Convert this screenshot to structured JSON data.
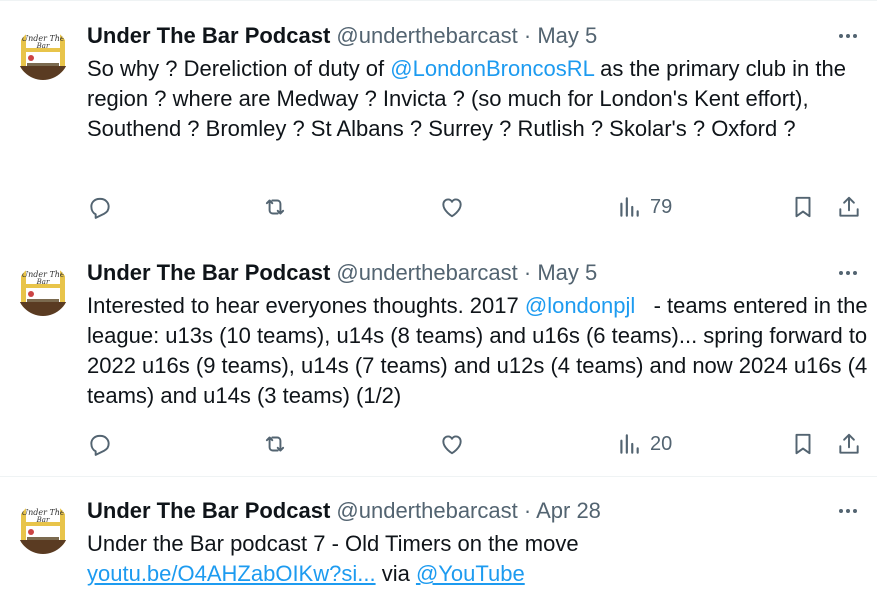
{
  "colors": {
    "text": "#0f1419",
    "secondary": "#536471",
    "link": "#1d9bf0",
    "divider": "#eff3f4"
  },
  "icons": {
    "more": "more-horizontal-icon",
    "reply": "reply-icon",
    "retweet": "retweet-icon",
    "like": "heart-icon",
    "views": "views-bar-chart-icon",
    "bookmark": "bookmark-icon",
    "share": "share-icon"
  },
  "avatar": {
    "caption": "Under The Bar"
  },
  "tweets": [
    {
      "name": "Under The Bar Podcast",
      "handle": "@underthebarcast",
      "separator": "·",
      "date": "May 5",
      "text_before": "So why ? Dereliction of duty of ",
      "mention": "@LondonBroncosRL",
      "text_after": " as the primary club in the region ? where are Medway ? Invicta ? (so much for London's Kent effort), Southend ? Bromley ? St Albans ? Surrey ? Rutlish ? Skolar's ? Oxford ?",
      "views": "79"
    },
    {
      "name": "Under The Bar Podcast",
      "handle": "@underthebarcast",
      "separator": "·",
      "date": "May 5",
      "text_before": "Interested to hear everyones thoughts. 2017 ",
      "mention": "@londonpjl",
      "text_after": "   - teams entered in the league: u13s (10 teams), u14s (8 teams) and u16s (6 teams)... spring forward to 2022 u16s (9 teams), u14s (7 teams) and u12s (4 teams) and now 2024 u16s (4 teams) and u14s (3 teams) (1/2)",
      "views": "20"
    },
    {
      "name": "Under The Bar Podcast",
      "handle": "@underthebarcast",
      "separator": "·",
      "date": "Apr 28",
      "line1": "Under the Bar podcast 7 - Old Timers on the move",
      "url": "youtu.be/O4AHZabOIKw?si...",
      "via": " via ",
      "via_mention": "@YouTube"
    }
  ]
}
